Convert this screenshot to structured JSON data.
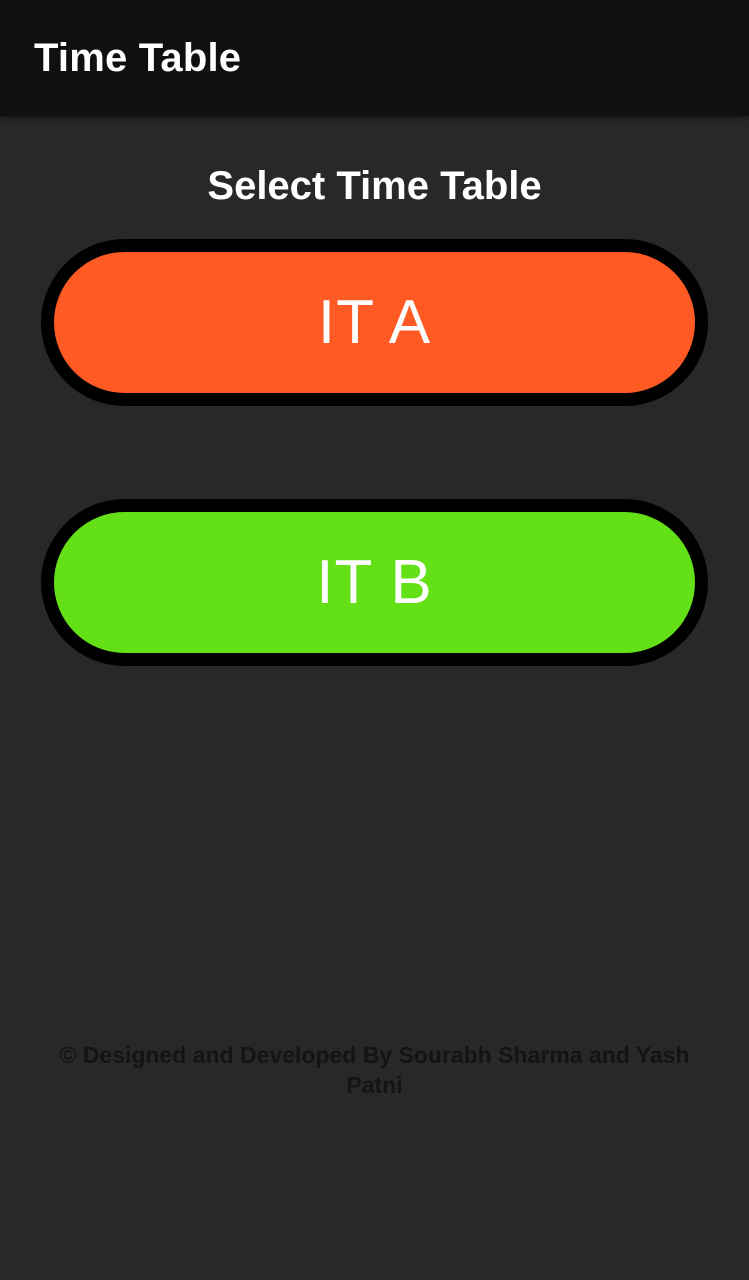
{
  "app_bar": {
    "title": "Time Table"
  },
  "main": {
    "heading": "Select Time Table",
    "buttons": [
      {
        "label": "IT A",
        "color": "#ff5a24"
      },
      {
        "label": "IT B",
        "color": "#63e016"
      }
    ]
  },
  "footer": {
    "credit": "© Designed and Developed By Sourabh Sharma and Yash Patni"
  },
  "colors": {
    "background": "#282828",
    "app_bar": "#0f1012",
    "button_border": "#000000"
  }
}
